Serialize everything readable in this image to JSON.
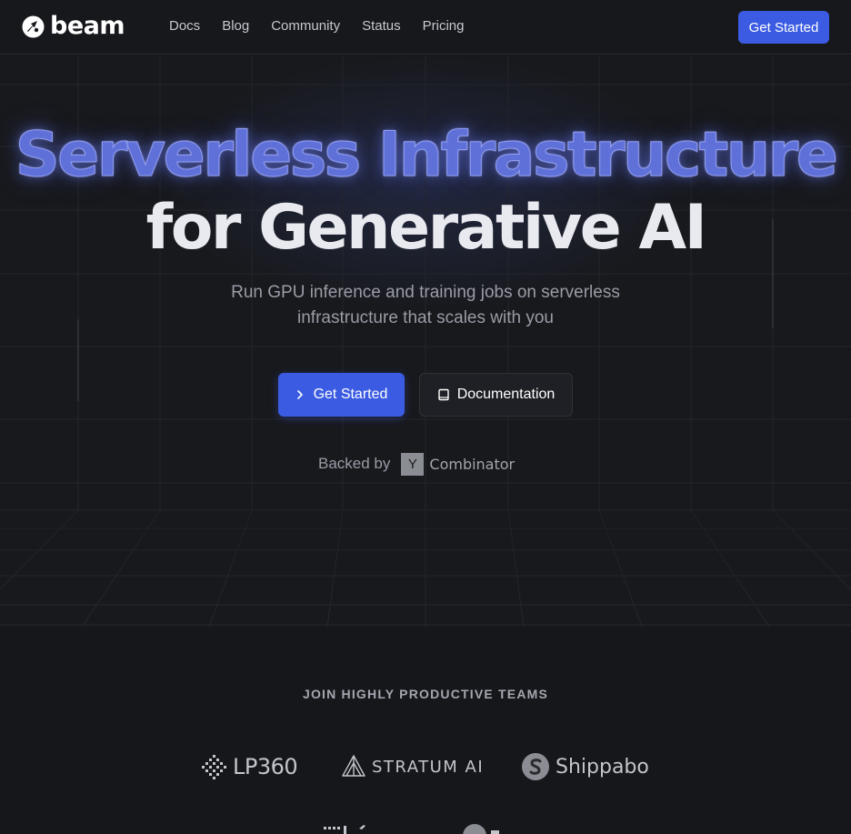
{
  "nav": {
    "brand": "beam",
    "links": [
      "Docs",
      "Blog",
      "Community",
      "Status",
      "Pricing"
    ],
    "cta": "Get Started"
  },
  "hero": {
    "title_line1": "Serverless Infrastructure",
    "title_line2": "for Generative AI",
    "subtitle_line1": "Run GPU inference and training jobs on serverless",
    "subtitle_line2": "infrastructure that scales with you",
    "primary_button": "Get Started",
    "secondary_button": "Documentation",
    "backed_label": "Backed by",
    "backer_mark": "Y",
    "backer_name": "Combinator"
  },
  "teams": {
    "heading": "JOIN HIGHLY PRODUCTIVE TEAMS",
    "logos": [
      {
        "name": "LP360",
        "icon": "lp360-logo-icon"
      },
      {
        "name": "STRATUM AI",
        "icon": "stratum-logo-icon"
      },
      {
        "name": "Shippabo",
        "icon": "shippabo-logo-icon"
      }
    ]
  },
  "colors": {
    "background": "#16171b",
    "accent": "#3b5ce2",
    "title_glow": "#5f70d8"
  }
}
